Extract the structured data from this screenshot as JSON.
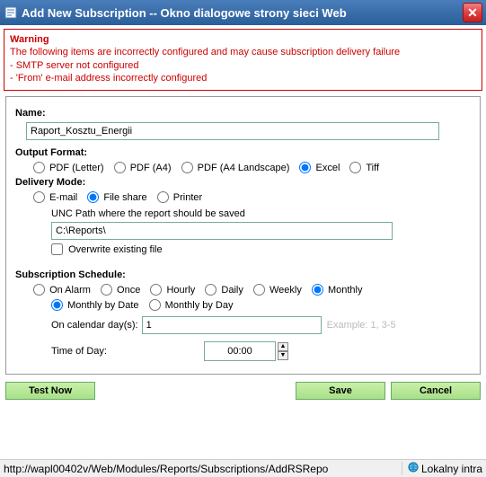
{
  "window": {
    "title": "Add New Subscription -- Okno dialogowe strony sieci Web"
  },
  "warning": {
    "title": "Warning",
    "line1": "The following items are incorrectly configured and may cause subscription delivery failure",
    "line2": "- SMTP server not configured",
    "line3": "- 'From' e-mail address incorrectly configured"
  },
  "labels": {
    "name": "Name:",
    "output_format": "Output Format:",
    "delivery_mode": "Delivery Mode:",
    "unc_hint": "UNC Path where the report should be saved",
    "overwrite": "Overwrite existing file",
    "sub_schedule": "Subscription Schedule:",
    "calendar_days": "On calendar day(s):",
    "example": "Example: 1, 3-5",
    "time_of_day": "Time of Day:"
  },
  "values": {
    "name": "Raport_Kosztu_Energii",
    "unc_path": "C:\\Reports\\",
    "calendar_days": "1",
    "time_of_day": "00:00"
  },
  "radios": {
    "format": {
      "pdf_letter": "PDF (Letter)",
      "pdf_a4": "PDF (A4)",
      "pdf_a4l": "PDF (A4 Landscape)",
      "excel": "Excel",
      "tiff": "Tiff"
    },
    "delivery": {
      "email": "E-mail",
      "fileshare": "File share",
      "printer": "Printer"
    },
    "schedule": {
      "onalarm": "On Alarm",
      "once": "Once",
      "hourly": "Hourly",
      "daily": "Daily",
      "weekly": "Weekly",
      "monthly": "Monthly"
    },
    "monthly": {
      "bydate": "Monthly by Date",
      "byday": "Monthly by Day"
    }
  },
  "buttons": {
    "testnow": "Test Now",
    "save": "Save",
    "cancel": "Cancel"
  },
  "status": {
    "url": "http://wapl00402v/Web/Modules/Reports/Subscriptions/AddRSRepo",
    "zone": "Lokalny intra"
  }
}
